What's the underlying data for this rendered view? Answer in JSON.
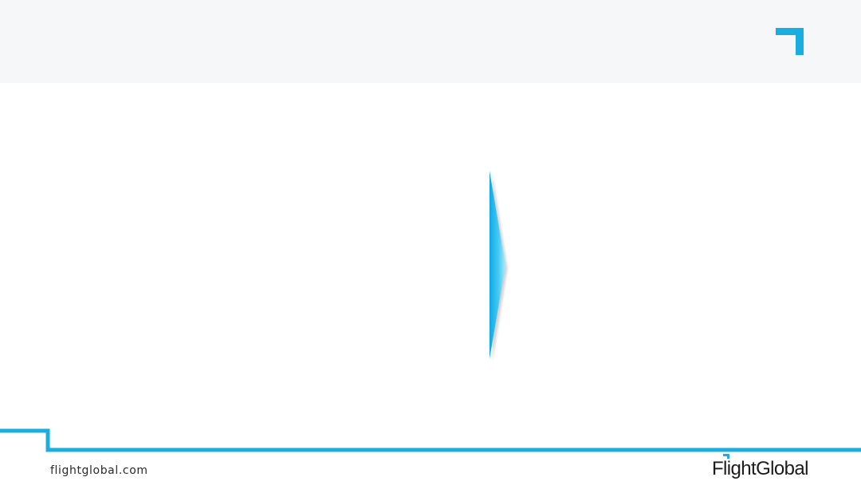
{
  "slide": {
    "background": "#ffffff",
    "header_color": "#f6f7f8"
  },
  "colors": {
    "accent": "#1aaee0",
    "text": "#2b2b2b"
  },
  "icons": {
    "corner_mark": "corner-bracket-icon",
    "chevron": "right-chevron-arrow-icon"
  },
  "footer": {
    "url": "flightglobal.com",
    "logo_text": "FlightGlobal"
  }
}
